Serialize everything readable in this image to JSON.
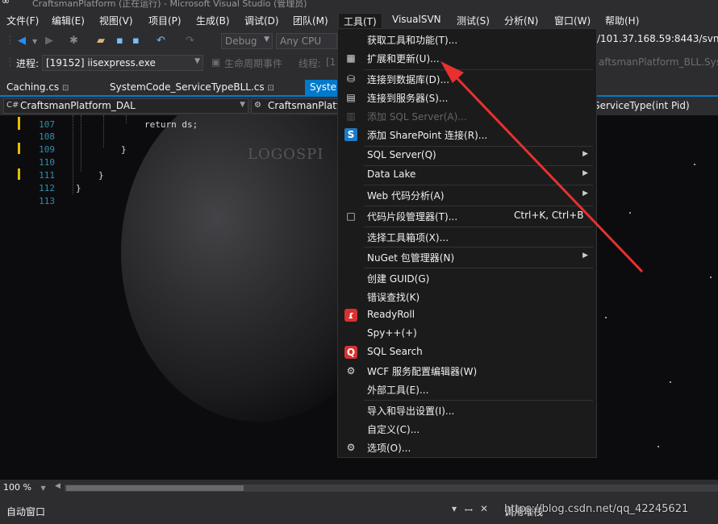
{
  "window": {
    "title": "CraftsmanPlatform (正在运行) - Microsoft Visual Studio (管理员)"
  },
  "menu": [
    {
      "label": "文件(F)"
    },
    {
      "label": "编辑(E)"
    },
    {
      "label": "视图(V)"
    },
    {
      "label": "项目(P)"
    },
    {
      "label": "生成(B)"
    },
    {
      "label": "调试(D)"
    },
    {
      "label": "团队(M)"
    },
    {
      "label": "工具(T)"
    },
    {
      "label": "VisualSVN"
    },
    {
      "label": "测试(S)"
    },
    {
      "label": "分析(N)"
    },
    {
      "label": "窗口(W)"
    },
    {
      "label": "帮助(H)"
    }
  ],
  "toolbar": {
    "config": "Debug",
    "platform": "Any CPU",
    "url": "/101.37.168.59:8443/svn/C",
    "process_label": "进程:",
    "process_value": "[19152] iisexpress.exe",
    "lifecycle": "生命周期事件",
    "thread_label": "线程:",
    "thread_value": "[1",
    "right_context": "aftsmanPlatform_BLL.Syste"
  },
  "tabs": [
    {
      "label": "Caching.cs"
    },
    {
      "label": "SystemCode_ServiceTypeBLL.cs"
    },
    {
      "label": "System"
    }
  ],
  "nav": {
    "project": "CraftsmanPlatform_DAL",
    "class": "CraftsmanPlatfo",
    "member": "ServiceType(int Pid)"
  },
  "code": {
    "lines": [
      {
        "no": "107",
        "text": "return ds;"
      },
      {
        "no": "108",
        "text": ""
      },
      {
        "no": "109",
        "text": "}"
      },
      {
        "no": "110",
        "text": ""
      },
      {
        "no": "111",
        "text": "}"
      },
      {
        "no": "112",
        "text": "}"
      },
      {
        "no": "113",
        "text": ""
      }
    ],
    "logo": "LOGOSPI"
  },
  "tools_menu": {
    "items": [
      {
        "label": "获取工具和功能(T)...",
        "icon": "",
        "shortcut": "",
        "submenu": false,
        "disabled": false
      },
      {
        "label": "扩展和更新(U)...",
        "icon": "extensions-icon",
        "shortcut": "",
        "submenu": false,
        "disabled": false
      },
      {
        "label": "连接到数据库(D)...",
        "icon": "database-icon",
        "shortcut": "",
        "submenu": false,
        "disabled": false
      },
      {
        "label": "连接到服务器(S)...",
        "icon": "server-icon",
        "shortcut": "",
        "submenu": false,
        "disabled": false
      },
      {
        "label": "添加 SQL Server(A)...",
        "icon": "sql-server-icon",
        "shortcut": "",
        "submenu": false,
        "disabled": true
      },
      {
        "label": "添加 SharePoint 连接(R)...",
        "icon": "sharepoint-icon",
        "shortcut": "",
        "submenu": false,
        "disabled": false
      },
      {
        "label": "SQL Server(Q)",
        "icon": "",
        "shortcut": "",
        "submenu": true,
        "disabled": false
      },
      {
        "label": "Data Lake",
        "icon": "",
        "shortcut": "",
        "submenu": true,
        "disabled": false
      },
      {
        "label": "Web 代码分析(A)",
        "icon": "",
        "shortcut": "",
        "submenu": true,
        "disabled": false
      },
      {
        "label": "代码片段管理器(T)...",
        "icon": "snippet-icon",
        "shortcut": "Ctrl+K, Ctrl+B",
        "submenu": false,
        "disabled": false
      },
      {
        "label": "选择工具箱项(X)...",
        "icon": "",
        "shortcut": "",
        "submenu": false,
        "disabled": false
      },
      {
        "label": "NuGet 包管理器(N)",
        "icon": "",
        "shortcut": "",
        "submenu": true,
        "disabled": false
      },
      {
        "label": "创建 GUID(G)",
        "icon": "",
        "shortcut": "",
        "submenu": false,
        "disabled": false
      },
      {
        "label": "错误查找(K)",
        "icon": "",
        "shortcut": "",
        "submenu": false,
        "disabled": false
      },
      {
        "label": "ReadyRoll",
        "icon": "readyroll-icon",
        "shortcut": "",
        "submenu": false,
        "disabled": false
      },
      {
        "label": "Spy++(+)",
        "icon": "",
        "shortcut": "",
        "submenu": false,
        "disabled": false
      },
      {
        "label": "SQL Search",
        "icon": "sql-search-icon",
        "shortcut": "",
        "submenu": false,
        "disabled": false
      },
      {
        "label": "WCF 服务配置编辑器(W)",
        "icon": "wcf-gear-icon",
        "shortcut": "",
        "submenu": false,
        "disabled": false
      },
      {
        "label": "外部工具(E)...",
        "icon": "",
        "shortcut": "",
        "submenu": false,
        "disabled": false
      },
      {
        "label": "导入和导出设置(I)...",
        "icon": "",
        "shortcut": "",
        "submenu": false,
        "disabled": false
      },
      {
        "label": "自定义(C)...",
        "icon": "",
        "shortcut": "",
        "submenu": false,
        "disabled": false
      },
      {
        "label": "选项(O)...",
        "icon": "gear-icon",
        "shortcut": "",
        "submenu": false,
        "disabled": false
      }
    ]
  },
  "status": {
    "zoom": "100 %"
  },
  "bottom": {
    "left_panel": "自动窗口",
    "right_panel": "调用堆栈",
    "watermark": "https://blog.csdn.net/qq_42245621"
  },
  "colors": {
    "accent": "#007acc",
    "annotation_arrow": "#e8312f"
  }
}
